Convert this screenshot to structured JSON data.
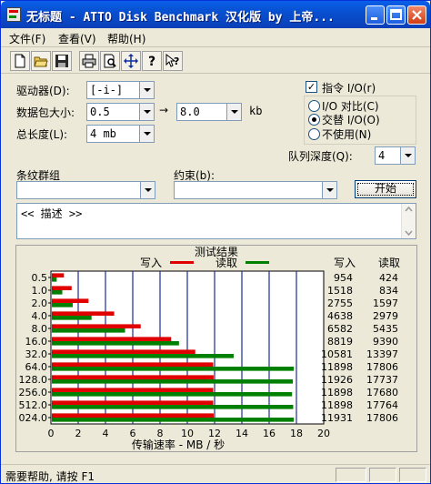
{
  "window": {
    "title": "无标题 - ATTO Disk Benchmark  汉化版 by 上帝..."
  },
  "menu": [
    "文件(F)",
    "查看(V)",
    "帮助(H)"
  ],
  "toolbar": {
    "icons": [
      "new-file-icon",
      "open-folder-icon",
      "save-icon",
      "print-icon",
      "print-preview-icon",
      "move-icon",
      "help-icon",
      "context-help-icon"
    ]
  },
  "form": {
    "drive_label": "驱动器(D):",
    "drive_value": "[-i-]",
    "packet_label": "数据包大小:",
    "packet_from": "0.5",
    "packet_to": "8.0",
    "packet_unit": "kb",
    "arrow": "→",
    "length_label": "总长度(L):",
    "length_value": "4 mb",
    "direct_io_label": "指令 I/O(r)",
    "direct_io_checked": true,
    "io_compare_label": "I/O 对比(C)",
    "overlapped_label": "交替 I/O(O)",
    "neither_label": "不使用(N)",
    "selected_mode": "overlapped",
    "queue_label": "队列深度(Q):",
    "queue_value": "4",
    "stripe_label": "条纹群组",
    "stripe_value": "",
    "constraint_label": "约束(b):",
    "constraint_value": "",
    "start_button": "开始",
    "description": "<< 描述 >>"
  },
  "chart_data": {
    "type": "bar",
    "title": "测试结果",
    "legend": [
      {
        "name": "写入",
        "color": "#e00000"
      },
      {
        "name": "读取",
        "color": "#008000"
      }
    ],
    "categories": [
      "0.5",
      "1.0",
      "2.0",
      "4.0",
      "8.0",
      "16.0",
      "32.0",
      "64.0",
      "128.0",
      "256.0",
      "512.0",
      "1024.0"
    ],
    "category_display": [
      "0.5",
      "1.0",
      "2.0",
      "4.0",
      "8.0",
      "16.0",
      "32.0",
      "64.0",
      "128.0",
      "256.0",
      "512.0",
      "024.0"
    ],
    "series": [
      {
        "name": "写入",
        "color": "#e00000",
        "values": [
          954,
          1518,
          2755,
          4638,
          6582,
          8819,
          10581,
          11898,
          11926,
          11898,
          11898,
          11931
        ]
      },
      {
        "name": "读取",
        "color": "#008000",
        "values": [
          424,
          834,
          1597,
          2979,
          5435,
          9390,
          13397,
          17806,
          17737,
          17680,
          17764,
          17806
        ]
      }
    ],
    "column_headers": [
      "写入",
      "读取"
    ],
    "xlabel": "传输速率 - MB / 秒",
    "xticks": [
      "0",
      "2",
      "4",
      "6",
      "8",
      "10",
      "12",
      "14",
      "16",
      "18",
      "20"
    ],
    "xlim": [
      0,
      20
    ],
    "value_scale": 1000,
    "grid": true
  },
  "status": {
    "text": "需要帮助, 请按 F1"
  }
}
